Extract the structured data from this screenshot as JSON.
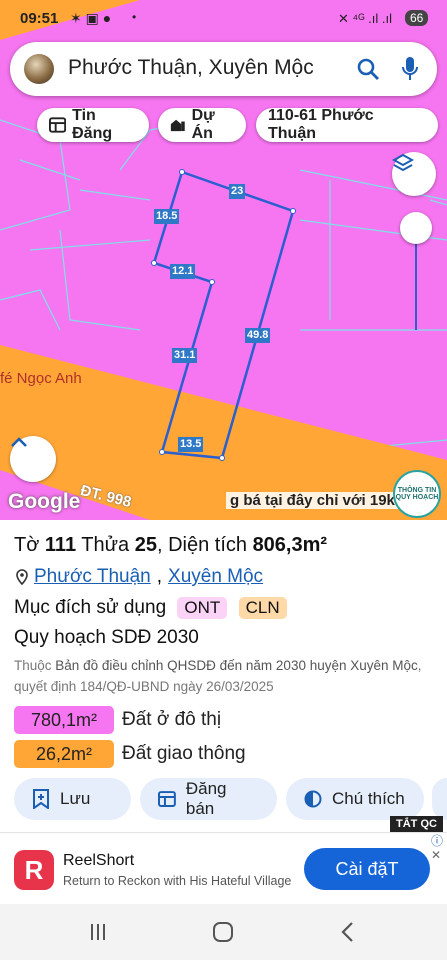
{
  "status": {
    "time": "09:51",
    "battery": "66"
  },
  "search": {
    "text": "Phước Thuận, Xuyên Mộc"
  },
  "chips": {
    "tin_dang": "Tin Đăng",
    "du_an": "Dự Án",
    "parcel": "110-61 Phước Thuận"
  },
  "map": {
    "place_label": "fé Ngọc Anh",
    "road_label": "ĐT. 998",
    "banner_text": "g bá tại đây chỉ với 19k",
    "google": "Google",
    "dims": [
      "23",
      "18.5",
      "12.1",
      "49.8",
      "31.1",
      "13.5"
    ],
    "info_badge": [
      "THÔNG TIN",
      "QUY HOẠCH"
    ],
    "colors": {
      "residential": "#f675f0",
      "road": "#ffa637",
      "parcel_line": "#2a5fd0"
    }
  },
  "panel": {
    "to_label": "Tờ",
    "to_value": "111",
    "thua_label": "Thửa",
    "thua_value": "25",
    "area_label": ", Diện tích",
    "area_value": "806,3m²",
    "commune": "Phước Thuận",
    "district": "Xuyên Mộc",
    "sep": ",",
    "purpose_label": "Mục đích sử dụng",
    "tag1": "ONT",
    "tag2": "CLN",
    "plan_label": "Quy hoạch SDĐ 2030",
    "source_prefix": "Thuộc",
    "source_main": "Bản đồ điều chỉnh QHSDĐ đến năm 2030 huyện Xuyên Mộc",
    "source_suffix": ", quyết định 184/QĐ-UBND ngày 26/03/2025",
    "land1_value": "780,1m²",
    "land1_label": "Đất ở đô thị",
    "land2_value": "26,2m²",
    "land2_label": "Đất giao thông",
    "actions": {
      "save": "Lưu",
      "post": "Đăng bán",
      "legend": "Chú thích"
    }
  },
  "ad": {
    "close_label": "TẮT QC",
    "app_name": "ReelShort",
    "subtitle": "Return to Reckon with His Hateful Village",
    "install": "Cài đặT"
  }
}
